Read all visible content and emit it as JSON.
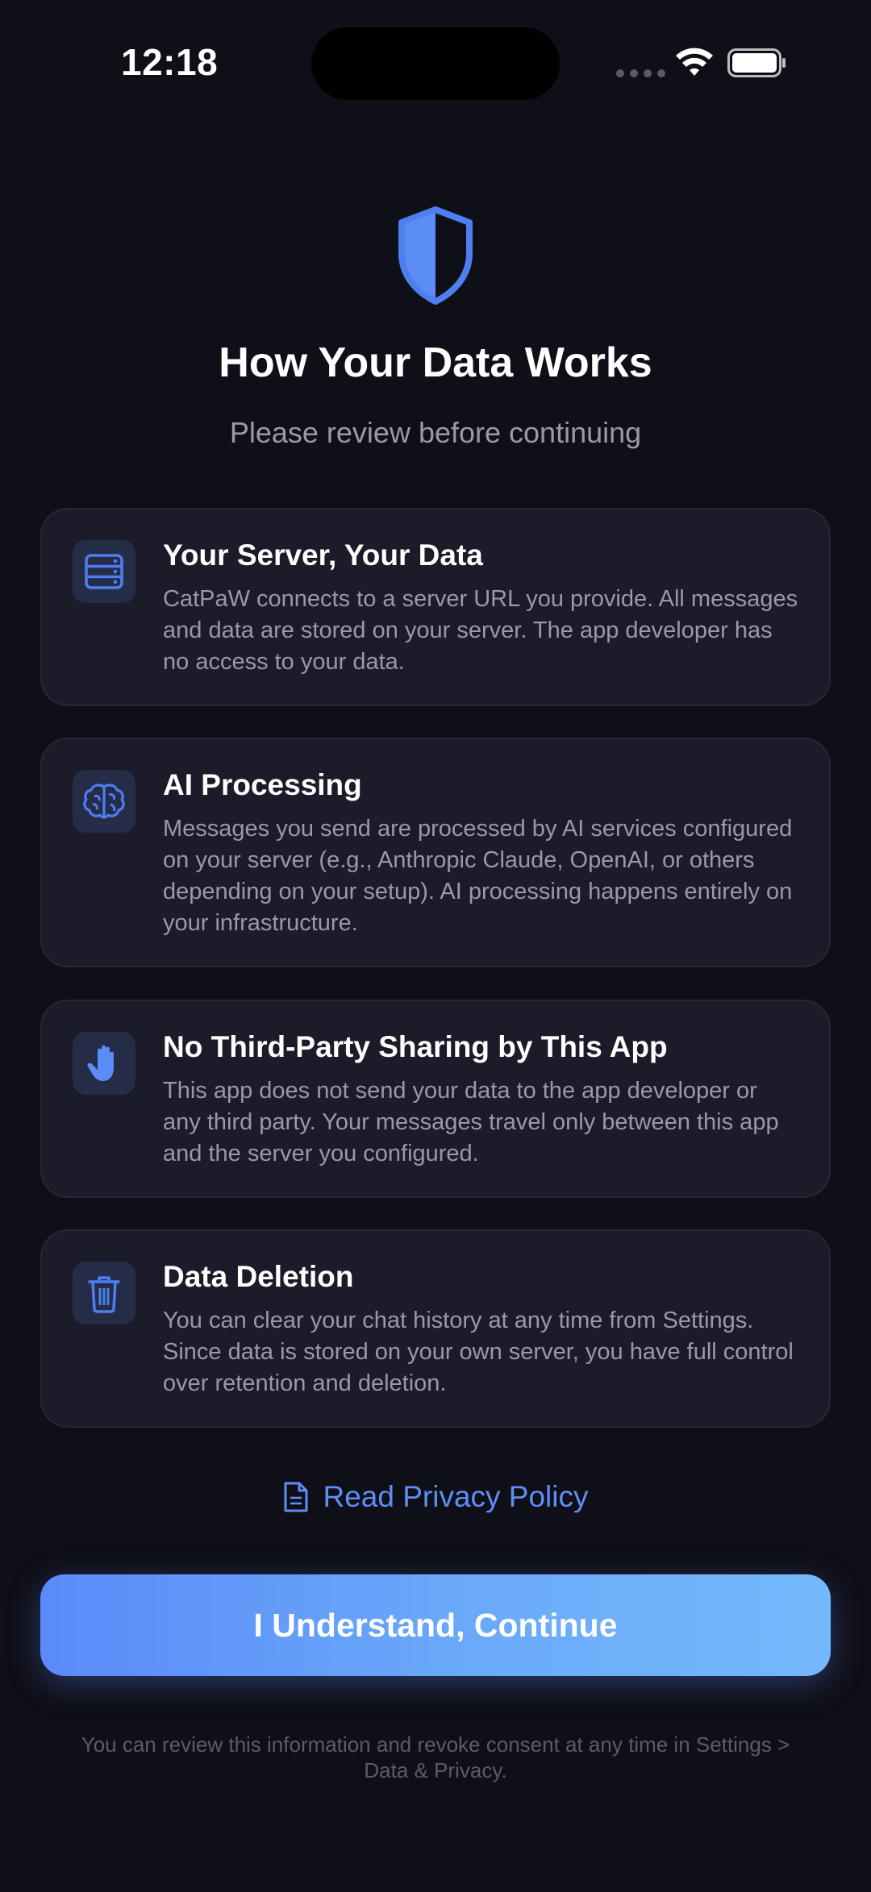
{
  "status_bar": {
    "time": "12:18"
  },
  "header": {
    "icon": "shield-icon",
    "title": "How Your Data Works",
    "subtitle": "Please review before continuing"
  },
  "cards": [
    {
      "icon": "server-icon",
      "title": "Your Server, Your Data",
      "body": "CatPaW connects to a server URL you provide. All messages and data are stored on your server. The app developer has no access to your data."
    },
    {
      "icon": "brain-icon",
      "title": "AI Processing",
      "body": "Messages you send are processed by AI services configured on your server (e.g., Anthropic Claude, OpenAI, or others depending on your setup). AI processing happens entirely on your infrastructure."
    },
    {
      "icon": "hand-icon",
      "title": "No Third-Party Sharing by This App",
      "body": "This app does not send your data to the app developer or any third party. Your messages travel only between this app and the server you configured."
    },
    {
      "icon": "trash-icon",
      "title": "Data Deletion",
      "body": "You can clear your chat history at any time from Settings. Since data is stored on your own server, you have full control over retention and deletion."
    }
  ],
  "privacy_link": {
    "icon": "document-icon",
    "label": "Read Privacy Policy"
  },
  "cta": {
    "label": "I Understand, Continue"
  },
  "footnote": "You can review this information and revoke consent at any time in Settings > Data & Privacy.",
  "colors": {
    "background": "#0f0f17",
    "card": "#1b1b29",
    "accent": "#5e8df5",
    "muted_text": "#9a9aa6"
  }
}
